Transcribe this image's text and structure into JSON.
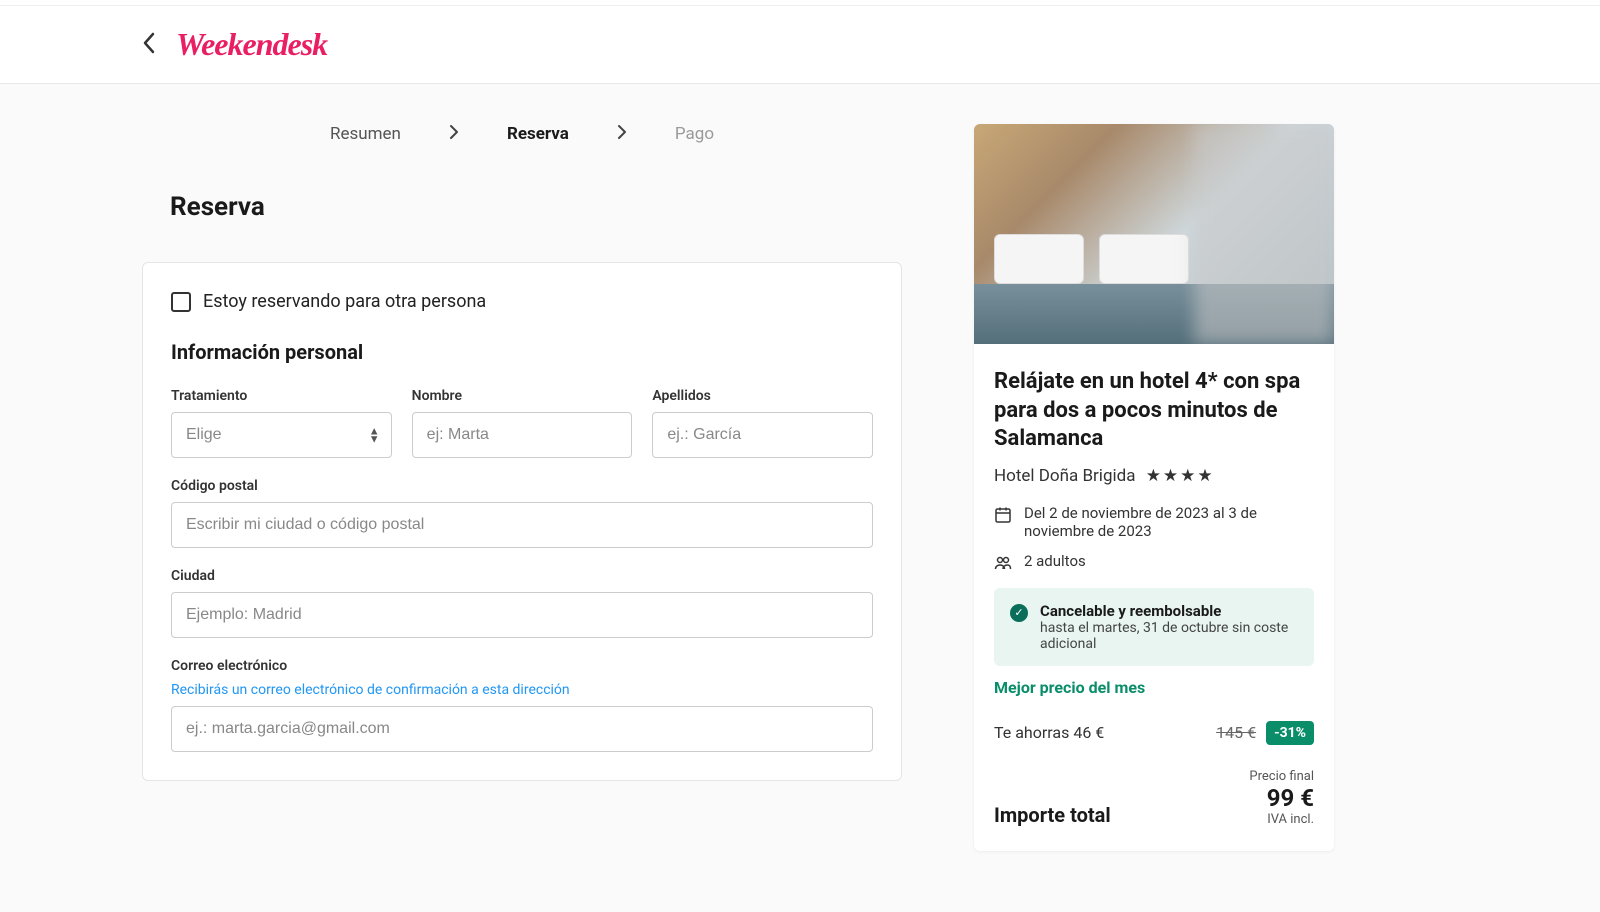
{
  "brand": "Weekendesk",
  "stepper": {
    "steps": [
      "Resumen",
      "Reserva",
      "Pago"
    ],
    "active_index": 1
  },
  "page_title": "Reserva",
  "form": {
    "other_person_label": "Estoy reservando para otra persona",
    "section_title": "Información personal",
    "treatment": {
      "label": "Tratamiento",
      "placeholder": "Elige"
    },
    "first_name": {
      "label": "Nombre",
      "placeholder": "ej: Marta"
    },
    "last_name": {
      "label": "Apellidos",
      "placeholder": "ej.: García"
    },
    "postal": {
      "label": "Código postal",
      "placeholder": "Escribir mi ciudad o código postal"
    },
    "city": {
      "label": "Ciudad",
      "placeholder": "Ejemplo: Madrid"
    },
    "email": {
      "label": "Correo electrónico",
      "help": "Recibirás un correo electrónico de confirmación a esta dirección",
      "placeholder": "ej.: marta.garcia@gmail.com"
    }
  },
  "summary": {
    "offer_title": "Relájate en un hotel 4* con spa para dos a pocos minutos de Salamanca",
    "hotel_name": "Hotel Doña Brigida",
    "stars": "★★★★",
    "dates": "Del 2 de noviembre de 2023 al 3 de noviembre de 2023",
    "guests": "2 adultos",
    "cancel_title": "Cancelable y reembolsable",
    "cancel_text": "hasta el martes, 31 de octubre sin coste adicional",
    "best_price": "Mejor precio del mes",
    "savings_text": "Te ahorras 46 €",
    "old_price": "145 €",
    "discount": "-31%",
    "total_label": "Importe total",
    "final_label": "Precio final",
    "final_price": "99 €",
    "vat": "IVA incl."
  }
}
